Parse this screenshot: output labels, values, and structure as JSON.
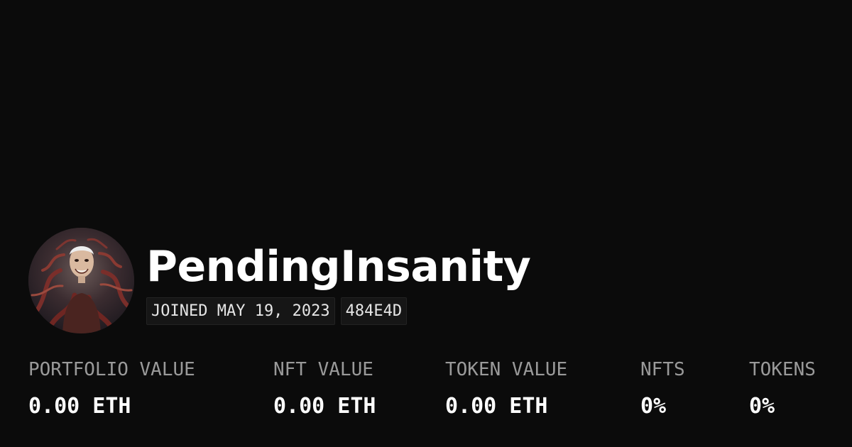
{
  "profile": {
    "username": "PendingInsanity",
    "joined": "JOINED MAY 19, 2023",
    "color_code": "484E4D",
    "avatar_icon": "profile-avatar-image"
  },
  "stats": [
    {
      "label": "PORTFOLIO VALUE",
      "value": "0.00 ETH"
    },
    {
      "label": "NFT VALUE",
      "value": "0.00 ETH"
    },
    {
      "label": "TOKEN VALUE",
      "value": "0.00 ETH"
    },
    {
      "label": "NFTS",
      "value": "0%"
    },
    {
      "label": "TOKENS",
      "value": "0%"
    }
  ],
  "colors": {
    "background": "#0b0b0b",
    "text_primary": "#ffffff",
    "text_secondary": "#9a9a9a",
    "tag_background": "#161616"
  }
}
